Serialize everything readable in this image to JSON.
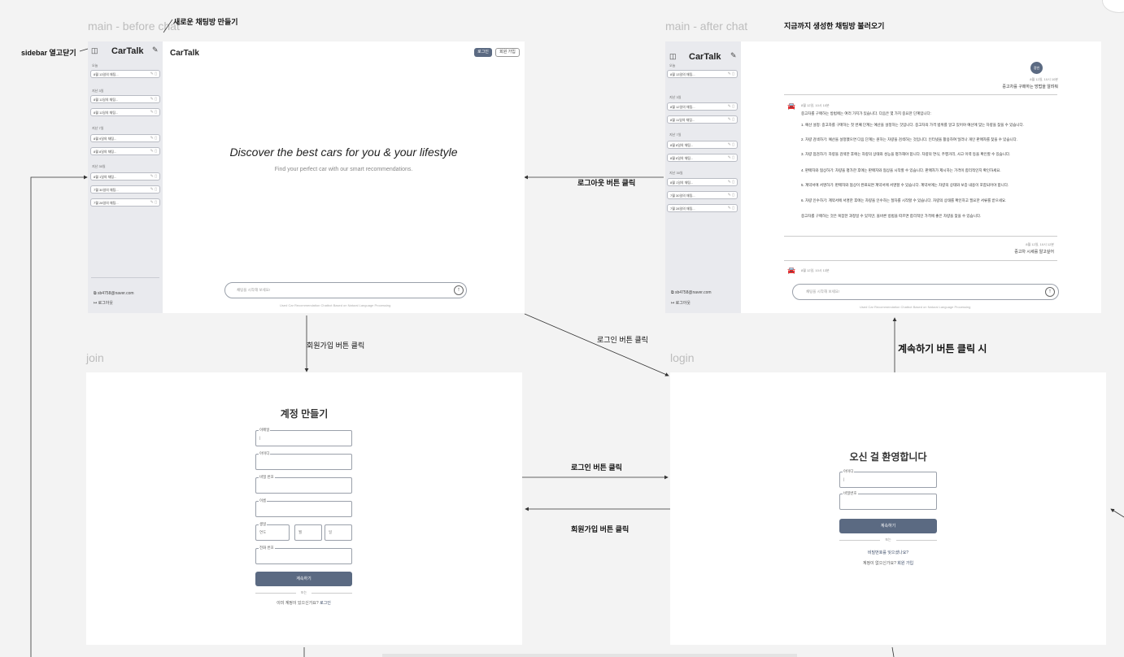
{
  "labels": {
    "main_before": "main - before chat",
    "main_after": "main - after chat",
    "join": "join",
    "login": "login"
  },
  "annotations": {
    "new_chat": "새로운 채팅방 만들기",
    "sidebar_toggle": "sidebar 열고닫기",
    "load_chats": "지금까지 생성한 채팅방 불러오기",
    "logout_click": "로그아웃 버튼 클릭",
    "signup_click": "회원가입 버튼 클릭",
    "login_click_diag": "로그인 버튼 클릭",
    "continue_click": "계속하기 버튼 클릭 시",
    "login_click": "로그인 버튼 클릭",
    "signup_click_2": "회원가입 버튼 클릭"
  },
  "before": {
    "sidebar_title": "CarTalk",
    "app_title": "CarTalk",
    "login_btn": "로그인",
    "signup_btn": "회원 가입",
    "groups": [
      {
        "label": "오늘",
        "items": [
          "8월 13일의 채팅..."
        ]
      },
      {
        "label": "지난 3일",
        "items": [
          "8월 11일의 채팅...",
          "8월 11일의 채팅..."
        ]
      },
      {
        "label": "지난 7일",
        "items": [
          "8월 9일의 채팅...",
          "8월 8일의 채팅..."
        ]
      },
      {
        "label": "지난 30일",
        "items": [
          "8월 1일의 채팅...",
          "7월 30일의 채팅...",
          "7월 28일의 채팅..."
        ]
      }
    ],
    "user_email": "sb4758@naver.com",
    "logout": "로그아웃",
    "hero_title": "Discover the best cars for you & your lifestyle",
    "hero_sub": "Find your perfect car with our smart recommendations.",
    "input_placeholder": "채팅을 시작해 보세요!",
    "footer": "Used Car Recommendation Chatbot Based on Natural Language Processing"
  },
  "after": {
    "sidebar_title": "CarTalk",
    "groups": [
      {
        "label": "오늘",
        "items": [
          "8월 13일의 채팅..."
        ]
      },
      {
        "label": "지난 3일",
        "items": [
          "8월 12일의 채팅...",
          "8월 11일의 채팅..."
        ]
      },
      {
        "label": "지난 7일",
        "items": [
          "8월 8일의 채팅...",
          "8월 6일의 채팅..."
        ]
      },
      {
        "label": "지난 30일",
        "items": [
          "8월 1일의 채팅...",
          "7월 30일의 채팅...",
          "7월 28일의 채팅..."
        ]
      }
    ],
    "user_email": "sb4758@naver.com",
    "logout": "로그아웃",
    "avatar": "정빈",
    "user_msg1_time": "8월 12일, 10시 10분",
    "user_msg1": "중고차를 구매하는 방법을 알려줘",
    "bot_time": "8월 12일, 10시 10분",
    "bot_lines": [
      "중고차를 구매하는 방법에는 여러 가지가 있습니다. 다음은 몇 가지 중요한 단계입니다:",
      "1. 예산 설정: 중고차를 구매하는 첫 번째 단계는 예산을 설정하는 것입니다. 중고차의 가격 범위를 알고 있어야 예산에 맞는 차량을 찾을 수 있습니다.",
      "2. 차량 검색하기: 예산을 설정했으면 다음 단계는 원하는 차량을 검색하는 것입니다. 인터넷을 활용하여 딜러나 개인 판매자를 찾을 수 있습니다.",
      "3. 차량 점검하기: 차량을 검색한 후에는 차량의 상태와 성능을 평가해야 합니다. 차량의 연식, 주행거리, 사고 이력 등을 확인할 수 있습니다.",
      "4. 판매자와 협상하기: 차량을 평가한 후에는 판매자와 협상을 시작할 수 있습니다. 판매자가 제시하는 가격이 합리적인지 확인하세요.",
      "5. 계약서에 서명하기: 판매자와 협상이 완료되면 계약서에 서명할 수 있습니다. 계약서에는 차량의 상태와 보증 내용이 포함되어야 합니다.",
      "6. 차량 인수하기: 계약서에 서명한 후에는 차량을 인수하는 절차를 시작할 수 있습니다. 차량의 상태를 확인하고 필요한 서류를 받으세요.",
      "중고차를 구매하는 것은 복잡한 과정일 수 있지만, 올바른 방법을 따르면 합리적인 가격에 좋은 차량을 찾을 수 있습니다."
    ],
    "user_msg2_time": "8월 12일, 10시 12분",
    "user_msg2": "중고차 시세를 알고싶어",
    "bot2_time": "8월 12일, 10시 13분",
    "input_placeholder": "채팅을 시작해 보세요!",
    "footer": "Used Car Recommendation Chatbot Based on Natural Language Processing"
  },
  "join": {
    "title": "계정 만들기",
    "email_label": "이메일",
    "id_label": "아이디",
    "pw_label": "비밀 번호",
    "name_label": "이름",
    "birth_label": "생일",
    "year_ph": "연도",
    "month_ph": "월",
    "day_ph": "일",
    "phone_label": "전화 번호",
    "continue": "계속하기",
    "or": "또는",
    "have_account": "이미 계정이 있으신가요?",
    "login_link": "로그인"
  },
  "login": {
    "title": "오신 걸 환영합니다",
    "id_label": "아이디",
    "pw_label": "비밀번호",
    "continue": "계속하기",
    "or": "또는",
    "forgot": "비밀번호를 잊으셨나요?",
    "no_account": "계정이 없으신가요?",
    "signup_link": "회원 가입"
  }
}
